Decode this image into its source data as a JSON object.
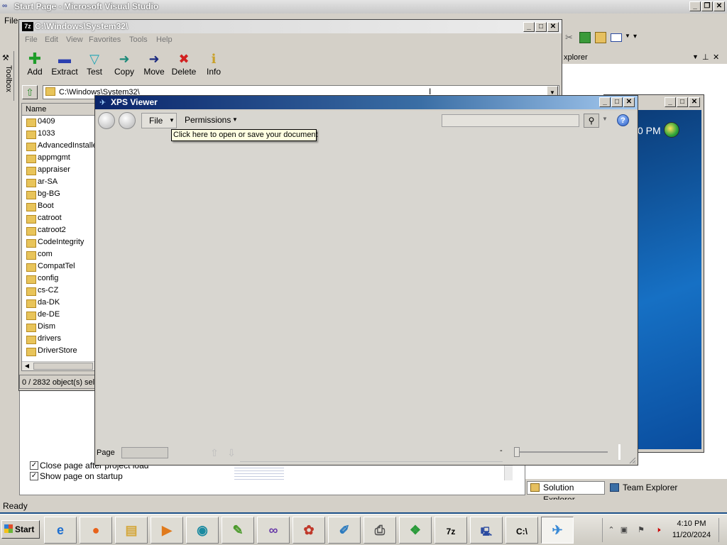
{
  "vs": {
    "title": "Start Page - Microsoft Visual Studio",
    "menu_file": "File",
    "toolbox_label": "Toolbox",
    "solution_explorer_header": "xplorer",
    "status": "Ready",
    "checkboxes": [
      {
        "label": "Close page after project load",
        "checked": true
      },
      {
        "label": "Show page on startup",
        "checked": true
      }
    ],
    "tabs": {
      "solution_explorer": "Solution Explorer",
      "team_explorer": "Team Explorer"
    },
    "window_controls": [
      "_",
      "❐",
      "✕"
    ]
  },
  "win7": {
    "clock": "0 PM",
    "window_controls": [
      "_",
      "□",
      "✕"
    ]
  },
  "zip": {
    "logo": "7z",
    "title": "C:\\Windows\\System32\\",
    "menu": [
      "File",
      "Edit",
      "View",
      "Favorites",
      "Tools",
      "Help"
    ],
    "tools": [
      {
        "label": "Add",
        "icon": "plus-icon",
        "glyph": "✚",
        "color": "#1f9d2a"
      },
      {
        "label": "Extract",
        "icon": "minus-icon",
        "glyph": "▬",
        "color": "#2b3fb0"
      },
      {
        "label": "Test",
        "icon": "check-icon",
        "glyph": "✓",
        "color": "#1fa4b5"
      },
      {
        "label": "Copy",
        "icon": "copy-arrow-icon",
        "glyph": "➜",
        "color": "#1c8a7a"
      },
      {
        "label": "Move",
        "icon": "move-arrow-icon",
        "glyph": "➜",
        "color": "#1b2a80"
      },
      {
        "label": "Delete",
        "icon": "delete-x-icon",
        "glyph": "✖",
        "color": "#d22020"
      },
      {
        "label": "Info",
        "icon": "info-icon",
        "glyph": "ℹ",
        "color": "#c9a12a"
      }
    ],
    "path": "C:\\Windows\\System32\\",
    "column_name": "Name",
    "folders": [
      "0409",
      "1033",
      "AdvancedInstalle",
      "appmgmt",
      "appraiser",
      "ar-SA",
      "bg-BG",
      "Boot",
      "catroot",
      "catroot2",
      "CodeIntegrity",
      "com",
      "CompatTel",
      "config",
      "cs-CZ",
      "da-DK",
      "de-DE",
      "Dism",
      "drivers",
      "DriverStore"
    ],
    "status": "0 / 2832 object(s) sel",
    "window_controls": [
      "_",
      "□",
      "✕"
    ]
  },
  "xps": {
    "title": "XPS Viewer",
    "file_label": "File",
    "permissions_label": "Permissions",
    "tooltip": "Click here to open or save your document",
    "help": "?",
    "page_label": "Page",
    "window_controls": [
      "_",
      "□",
      "✕"
    ]
  },
  "taskbar": {
    "start_label": "Start",
    "time": "4:10 PM",
    "date": "11/20/2024",
    "apps": [
      {
        "name": "internet-explorer-icon",
        "glyph": "e",
        "color": "#1e6fd0"
      },
      {
        "name": "firefox-icon",
        "glyph": "●",
        "color": "#e8621a"
      },
      {
        "name": "file-explorer-icon",
        "glyph": "▤",
        "color": "#d4a73a"
      },
      {
        "name": "media-player-icon",
        "glyph": "▶",
        "color": "#e07a1c"
      },
      {
        "name": "globe-app-icon",
        "glyph": "◉",
        "color": "#1a8aa0"
      },
      {
        "name": "notepad-plus-icon",
        "glyph": "✎",
        "color": "#4a9a2a"
      },
      {
        "name": "visual-studio-icon",
        "glyph": "∞",
        "color": "#6a3ca8"
      },
      {
        "name": "paint-icon",
        "glyph": "✿",
        "color": "#c0392b"
      },
      {
        "name": "notepad-icon",
        "glyph": "✐",
        "color": "#2a7abf"
      },
      {
        "name": "printer-icon",
        "glyph": "⎙",
        "color": "#555555"
      },
      {
        "name": "windows-update-icon",
        "glyph": "❖",
        "color": "#2a9a3a"
      },
      {
        "name": "sevenzip-icon",
        "glyph": "7z",
        "color": "#000000"
      },
      {
        "name": "network-computer-icon",
        "glyph": "🖳",
        "color": "#2a4aa0"
      },
      {
        "name": "command-prompt-icon",
        "glyph": "C:\\",
        "color": "#000000"
      },
      {
        "name": "xps-viewer-icon",
        "glyph": "✈",
        "color": "#3a8ad6"
      }
    ]
  }
}
